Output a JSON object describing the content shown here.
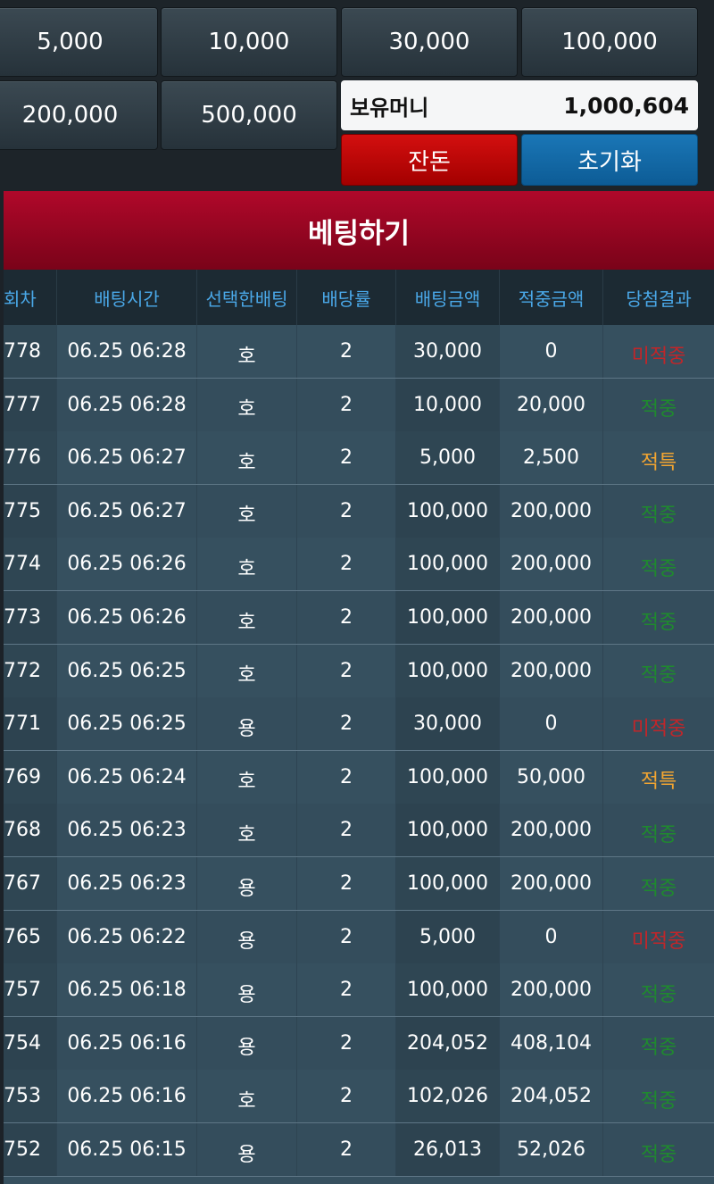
{
  "chips": [
    "5,000",
    "10,000",
    "30,000",
    "100,000",
    "200,000",
    "500,000"
  ],
  "balance": {
    "label": "보유머니",
    "value": "1,000,604"
  },
  "buttons": {
    "cashout": "잔돈",
    "reset": "초기화"
  },
  "bet_bar": {
    "title": "베팅하기"
  },
  "table": {
    "headers": [
      "회차",
      "배팅시간",
      "선택한배팅",
      "배당률",
      "배팅금액",
      "적중금액",
      "당첨결과"
    ],
    "rows": [
      {
        "round": "778",
        "time": "06.25 06:28",
        "pick": "호",
        "odds": "2",
        "bet": "30,000",
        "win": "0",
        "result": "미적중",
        "type": "lose"
      },
      {
        "round": "777",
        "time": "06.25 06:28",
        "pick": "호",
        "odds": "2",
        "bet": "10,000",
        "win": "20,000",
        "result": "적중",
        "type": "win"
      },
      {
        "round": "776",
        "time": "06.25 06:27",
        "pick": "호",
        "odds": "2",
        "bet": "5,000",
        "win": "2,500",
        "result": "적특",
        "type": "special"
      },
      {
        "round": "775",
        "time": "06.25 06:27",
        "pick": "호",
        "odds": "2",
        "bet": "100,000",
        "win": "200,000",
        "result": "적중",
        "type": "win"
      },
      {
        "round": "774",
        "time": "06.25 06:26",
        "pick": "호",
        "odds": "2",
        "bet": "100,000",
        "win": "200,000",
        "result": "적중",
        "type": "win"
      },
      {
        "round": "773",
        "time": "06.25 06:26",
        "pick": "호",
        "odds": "2",
        "bet": "100,000",
        "win": "200,000",
        "result": "적중",
        "type": "win"
      },
      {
        "round": "772",
        "time": "06.25 06:25",
        "pick": "호",
        "odds": "2",
        "bet": "100,000",
        "win": "200,000",
        "result": "적중",
        "type": "win"
      },
      {
        "round": "771",
        "time": "06.25 06:25",
        "pick": "용",
        "odds": "2",
        "bet": "30,000",
        "win": "0",
        "result": "미적중",
        "type": "lose"
      },
      {
        "round": "769",
        "time": "06.25 06:24",
        "pick": "호",
        "odds": "2",
        "bet": "100,000",
        "win": "50,000",
        "result": "적특",
        "type": "special"
      },
      {
        "round": "768",
        "time": "06.25 06:23",
        "pick": "호",
        "odds": "2",
        "bet": "100,000",
        "win": "200,000",
        "result": "적중",
        "type": "win"
      },
      {
        "round": "767",
        "time": "06.25 06:23",
        "pick": "용",
        "odds": "2",
        "bet": "100,000",
        "win": "200,000",
        "result": "적중",
        "type": "win"
      },
      {
        "round": "765",
        "time": "06.25 06:22",
        "pick": "용",
        "odds": "2",
        "bet": "5,000",
        "win": "0",
        "result": "미적중",
        "type": "lose"
      },
      {
        "round": "757",
        "time": "06.25 06:18",
        "pick": "용",
        "odds": "2",
        "bet": "100,000",
        "win": "200,000",
        "result": "적중",
        "type": "win"
      },
      {
        "round": "754",
        "time": "06.25 06:16",
        "pick": "용",
        "odds": "2",
        "bet": "204,052",
        "win": "408,104",
        "result": "적중",
        "type": "win"
      },
      {
        "round": "753",
        "time": "06.25 06:16",
        "pick": "호",
        "odds": "2",
        "bet": "102,026",
        "win": "204,052",
        "result": "적중",
        "type": "win"
      },
      {
        "round": "752",
        "time": "06.25 06:15",
        "pick": "용",
        "odds": "2",
        "bet": "26,013",
        "win": "52,026",
        "result": "적중",
        "type": "win"
      }
    ]
  },
  "colors": {
    "lose": "#c0262a",
    "win": "#1f8a2e",
    "special": "#f2a531",
    "header_text": "#4aa8e8",
    "bet_bar": "#9c0624"
  }
}
